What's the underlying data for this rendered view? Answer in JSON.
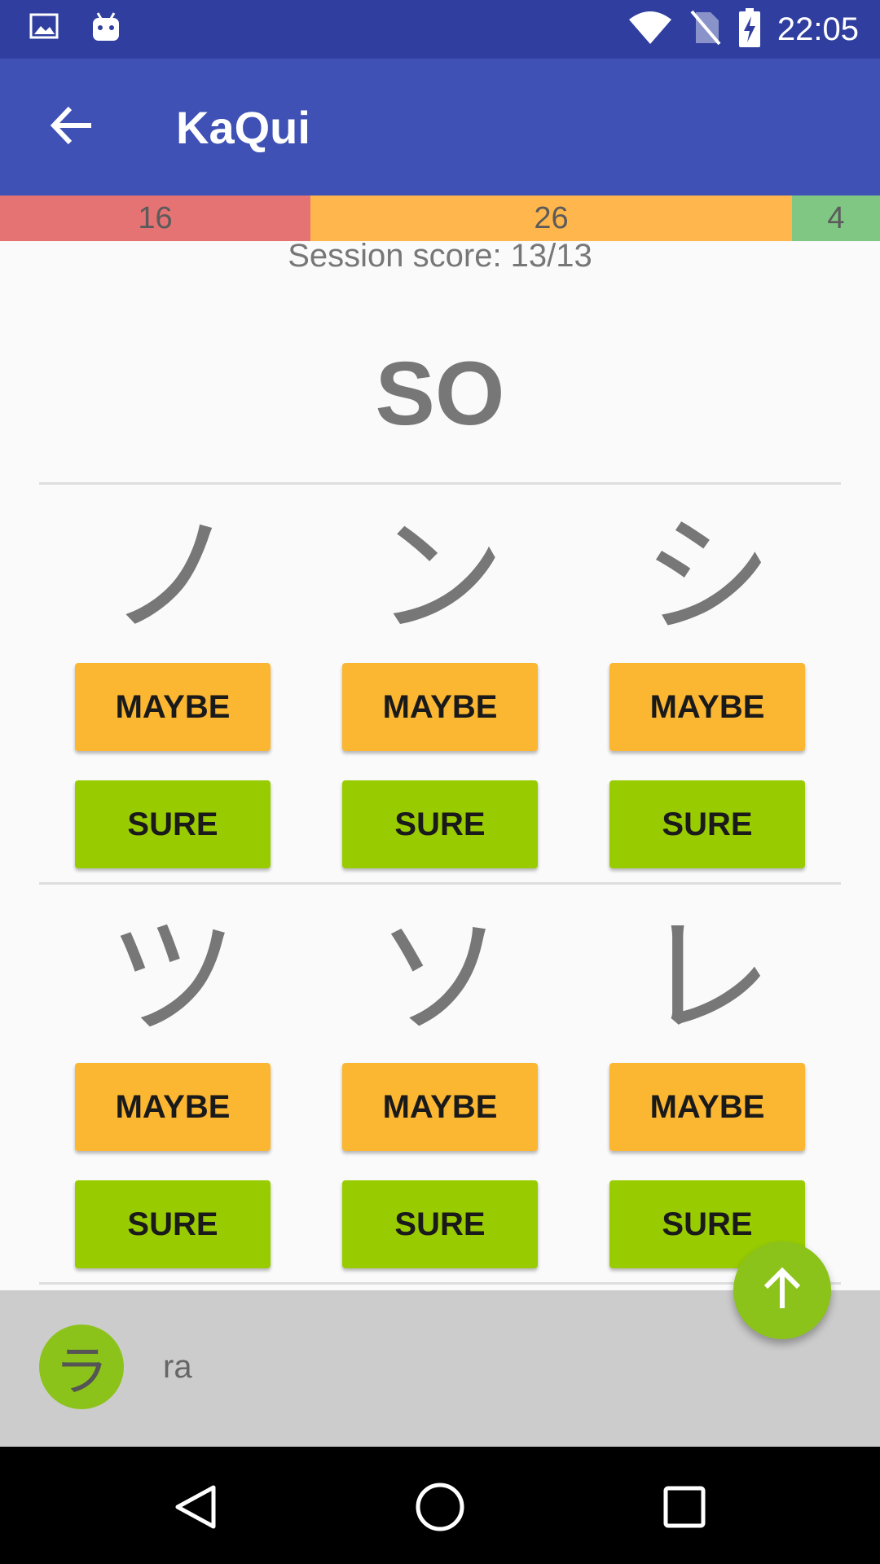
{
  "status_bar": {
    "time": "22:05",
    "icons": [
      "image-icon",
      "android-icon",
      "wifi-icon",
      "no-sim-icon",
      "battery-charging-icon"
    ]
  },
  "app_bar": {
    "title": "KaQui",
    "back_icon": "arrow-back-icon"
  },
  "progress": {
    "red_count": "16",
    "orange_count": "26",
    "green_count": "4",
    "colors": {
      "red": "#e57373",
      "orange": "#ffb74d",
      "green": "#81c784"
    }
  },
  "session_score": "Session score: 13/13",
  "prompt": "SO",
  "choices": [
    {
      "kana": "ノ",
      "maybe": "MAYBE",
      "sure": "SURE"
    },
    {
      "kana": "ン",
      "maybe": "MAYBE",
      "sure": "SURE"
    },
    {
      "kana": "シ",
      "maybe": "MAYBE",
      "sure": "SURE"
    },
    {
      "kana": "ツ",
      "maybe": "MAYBE",
      "sure": "SURE"
    },
    {
      "kana": "ソ",
      "maybe": "MAYBE",
      "sure": "SURE"
    },
    {
      "kana": "レ",
      "maybe": "MAYBE",
      "sure": "SURE"
    }
  ],
  "history": {
    "kana": "ラ",
    "romaji": "ra"
  },
  "fab_icon": "arrow-up-icon",
  "colors": {
    "primary": "#3f51b5",
    "primary_dark": "#303f9f",
    "maybe": "#fbb632",
    "sure": "#99cc00",
    "accent": "#8cc31b"
  },
  "nav_icons": [
    "back-triangle-icon",
    "home-circle-icon",
    "recents-square-icon"
  ]
}
